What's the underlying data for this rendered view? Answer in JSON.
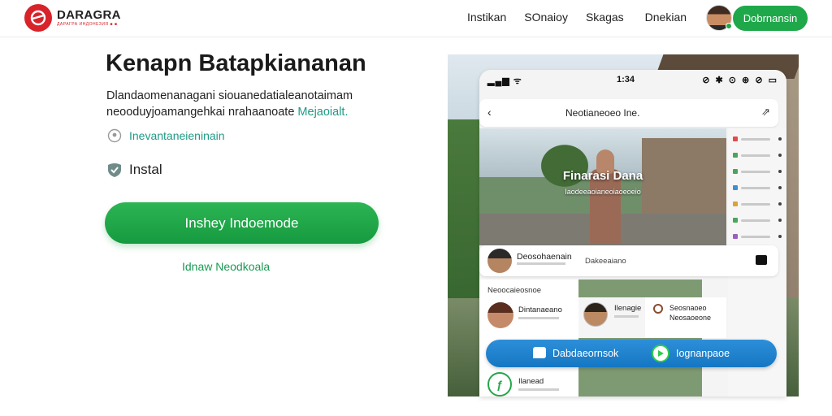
{
  "brand": {
    "name": "DARAGRA",
    "tagline": "ДАРАГРА ИНДОНЕЗИЯ ■ ■",
    "color": "#d8232a"
  },
  "nav": {
    "links": [
      "Instikan",
      "SOnaioy",
      "Skagas",
      "Dnekian"
    ],
    "cta_label": "Dobrnansin"
  },
  "hero": {
    "title": "Kenapn Batapkiananan",
    "desc_main": "Dlandaomenanagani siouanedatialeanotaimam neooduyjoamangehkai nrahaanoate",
    "desc_highlight": "Mejaoialt.",
    "feature1": "Inevantaneieninain",
    "feature2": "Instal",
    "primary_button": "Inshey Indoemode",
    "secondary_link": "Idnaw Neodkoala"
  },
  "phone": {
    "status_left": "▂▄▆ ᯤ",
    "time": "1:34",
    "status_right": "⊘ ✱ ⊙   ⊛ ⊘ ▭",
    "search_query": "Neotianeoeo Ine.",
    "video_title": "Finarasi Dana",
    "video_subtitle": "Iaodeeaoianeoiaoeoeio",
    "comment_name": "Deosohaenain",
    "comment_input": "Dakeeaiano",
    "list_header": "Neoocaieosnoe",
    "list_row1": "Dintanaeano",
    "mid_name": "Ilenagie",
    "right_line1": "Seosnaoeo",
    "right_line2": "Neosaoeone",
    "action_left": "Dabdaeornsok",
    "action_right": "Iognanpaoe",
    "bottom_name": "Ilanead"
  },
  "colors": {
    "green": "#1fa84a",
    "teal": "#1f9a86",
    "blue": "#1577c3"
  }
}
